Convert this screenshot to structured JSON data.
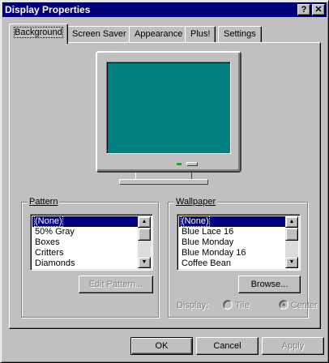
{
  "window": {
    "title": "Display Properties",
    "help_label": "?",
    "close_label": "✕"
  },
  "tabs": [
    {
      "label": "Background",
      "active": true
    },
    {
      "label": "Screen Saver",
      "active": false
    },
    {
      "label": "Appearance",
      "active": false
    },
    {
      "label": "Plus!",
      "active": false
    },
    {
      "label": "Settings",
      "active": false
    }
  ],
  "preview": {
    "desktop_color": "#008080"
  },
  "pattern": {
    "label": "Pattern",
    "items": [
      "(None)",
      "50% Gray",
      "Boxes",
      "Critters",
      "Diamonds"
    ],
    "selected": "(None)",
    "edit_button": "Edit Pattern..."
  },
  "wallpaper": {
    "label": "Wallpaper",
    "items": [
      "(None)",
      "Blue Lace 16",
      "Blue Monday",
      "Blue Monday 16",
      "Coffee Bean"
    ],
    "selected": "(None)",
    "browse_button": "Browse...",
    "display_label": "Display:",
    "tile_label": "Tile",
    "center_label": "Center",
    "display_mode": "Center"
  },
  "footer": {
    "ok": "OK",
    "cancel": "Cancel",
    "apply": "Apply"
  },
  "colors": {
    "titlebar": "#000080",
    "face": "#c0c0c0",
    "selection": "#000080"
  }
}
